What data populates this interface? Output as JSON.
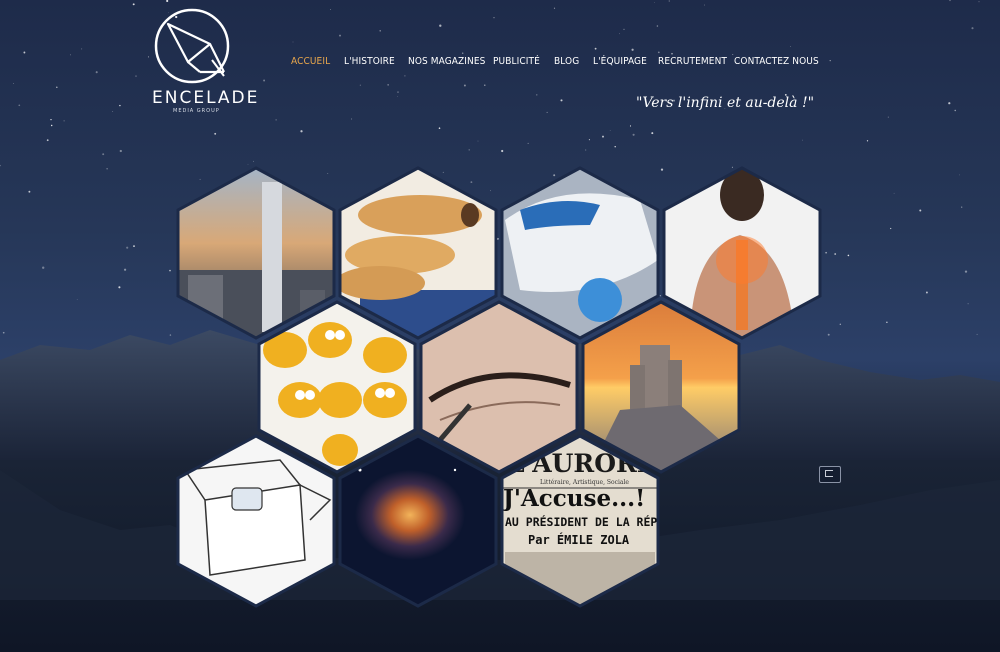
{
  "logo": {
    "name": "ENCELADE",
    "subtitle": "MEDIA GROUP"
  },
  "nav": {
    "items": [
      {
        "label": "Accueil",
        "active": true
      },
      {
        "label": "L'histoire",
        "active": false
      },
      {
        "label": "Nos magazines",
        "active": false
      },
      {
        "label": "Publicité",
        "active": false
      },
      {
        "label": "Blog",
        "active": false
      },
      {
        "label": "L'équipage",
        "active": false
      },
      {
        "label": "Recrutement",
        "active": false
      },
      {
        "label": "Contactez nous",
        "active": false
      }
    ]
  },
  "tagline": "\"Vers l'infini et au-delà !\"",
  "tiles": [
    {
      "subject": "skyscraper"
    },
    {
      "subject": "pastries"
    },
    {
      "subject": "concept-car"
    },
    {
      "subject": "back-pain"
    },
    {
      "subject": "googly-eye-stones"
    },
    {
      "subject": "eyeliner"
    },
    {
      "subject": "castle-sunset"
    },
    {
      "subject": "cat-in-box"
    },
    {
      "subject": "nebula"
    },
    {
      "subject": "newspaper",
      "lines": [
        "L'AURORE",
        "Littéraire, Artistique, Sociale",
        "J'Accuse...!",
        "AU PRÉSIDENT DE LA RÉP",
        "Par ÉMILE ZOLA"
      ]
    }
  ],
  "colors": {
    "accent": "#e8a64c",
    "nav_text": "#ffffff",
    "background": "#1e2b4a"
  }
}
